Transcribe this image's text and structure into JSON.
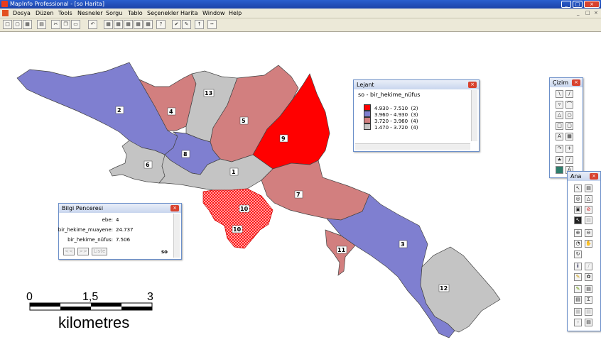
{
  "window": {
    "title": "MapInfo Professional - [so Harita]",
    "controls": [
      "_",
      "□",
      "×"
    ]
  },
  "menu": [
    "Dosya",
    "Düzen",
    "Tools",
    "Nesneler",
    "Sorgu",
    "Tablo",
    "Seçenekler",
    "Harita",
    "Window",
    "Help"
  ],
  "mdi_controls": [
    "_",
    "□",
    "×"
  ],
  "toolbar": {
    "buttons": [
      "new-icon",
      "open-icon",
      "save-icon",
      "print-icon",
      "cut-icon",
      "copy-icon",
      "paste-icon",
      "undo-icon",
      "new-browser-icon",
      "new-map-icon",
      "new-graph-icon",
      "new-layout-icon",
      "new-redistrict-icon",
      "help-icon",
      "hotlink-icon",
      "drawing-icon",
      "north-arrow-icon",
      "scale-bar-icon"
    ]
  },
  "map": {
    "regions": [
      {
        "id": "1",
        "fill": "#c4c4c4"
      },
      {
        "id": "2",
        "fill": "#7f7fd0"
      },
      {
        "id": "3",
        "fill": "#7f7fd0"
      },
      {
        "id": "4",
        "fill": "#d27f7f"
      },
      {
        "id": "5",
        "fill": "#d27f7f"
      },
      {
        "id": "6",
        "fill": "#c4c4c4"
      },
      {
        "id": "7",
        "fill": "#d27f7f"
      },
      {
        "id": "8",
        "fill": "#7f7fd0"
      },
      {
        "id": "9",
        "fill": "#ff0000"
      },
      {
        "id": "10",
        "fill": "#ff0000"
      },
      {
        "id": "11",
        "fill": "#d27f7f"
      },
      {
        "id": "12",
        "fill": "#c4c4c4"
      },
      {
        "id": "13",
        "fill": "#c4c4c4"
      }
    ],
    "selected_labels": [
      "10",
      "10"
    ],
    "scalebar": {
      "ticks": [
        "0",
        "1,5",
        "3"
      ],
      "unit": "kilometres"
    }
  },
  "legend": {
    "title": "Lejant",
    "heading": "so - bir_hekime_nüfus",
    "items": [
      {
        "range": "4.930 - 7.510",
        "count": "(2)",
        "color": "#ff0000"
      },
      {
        "range": "3.960 - 4.930",
        "count": "(3)",
        "color": "#7f7fd0"
      },
      {
        "range": "3.720 - 3.960",
        "count": "(4)",
        "color": "#d27f7f"
      },
      {
        "range": "1.470 - 3.720",
        "count": "(4)",
        "color": "#c4c4c4"
      }
    ]
  },
  "info": {
    "title": "Bilgi Penceresi",
    "rows": [
      {
        "label": "ebe:",
        "value": "4"
      },
      {
        "label": "bir_hekime_muayene:",
        "value": "24.737"
      },
      {
        "label": "bir_hekime_nüfus:",
        "value": "7.506"
      }
    ],
    "nav_prev": "<<",
    "nav_next": ">>",
    "list_label": "Liste",
    "table_name": "so"
  },
  "cizim": {
    "title": "Çizim"
  },
  "ana": {
    "title": "Ana"
  }
}
